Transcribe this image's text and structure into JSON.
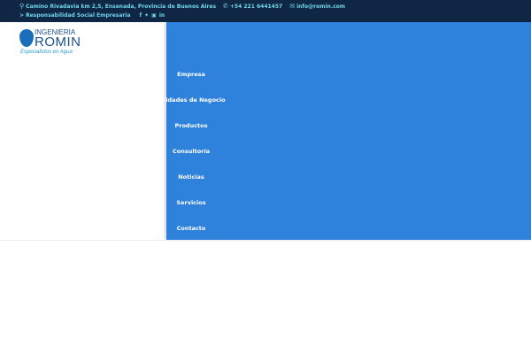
{
  "topbar": {
    "address": "Camino Rivadavia km 2,5, Ensenada, Provincia de Buenos Aires",
    "phone": "+54 221 6441457",
    "email": "info@romin.com",
    "rse_link": "> Responsabilidad Social Empresaria",
    "social": [
      "facebook",
      "twitter",
      "instagram",
      "linkedin"
    ]
  },
  "logo": {
    "line1": "INGENIERIA",
    "line2": "ROMIN",
    "tagline": "Especialistos en Agua"
  },
  "menu": {
    "items": [
      "Empresa",
      "Unidades de Negocio",
      "Productos",
      "Consultoría",
      "Noticias",
      "Servicios",
      "Contacto"
    ]
  },
  "colors": {
    "topbar": "#0f2744",
    "accent": "#6fd6ea",
    "menu_bg": "#2f82dc"
  }
}
